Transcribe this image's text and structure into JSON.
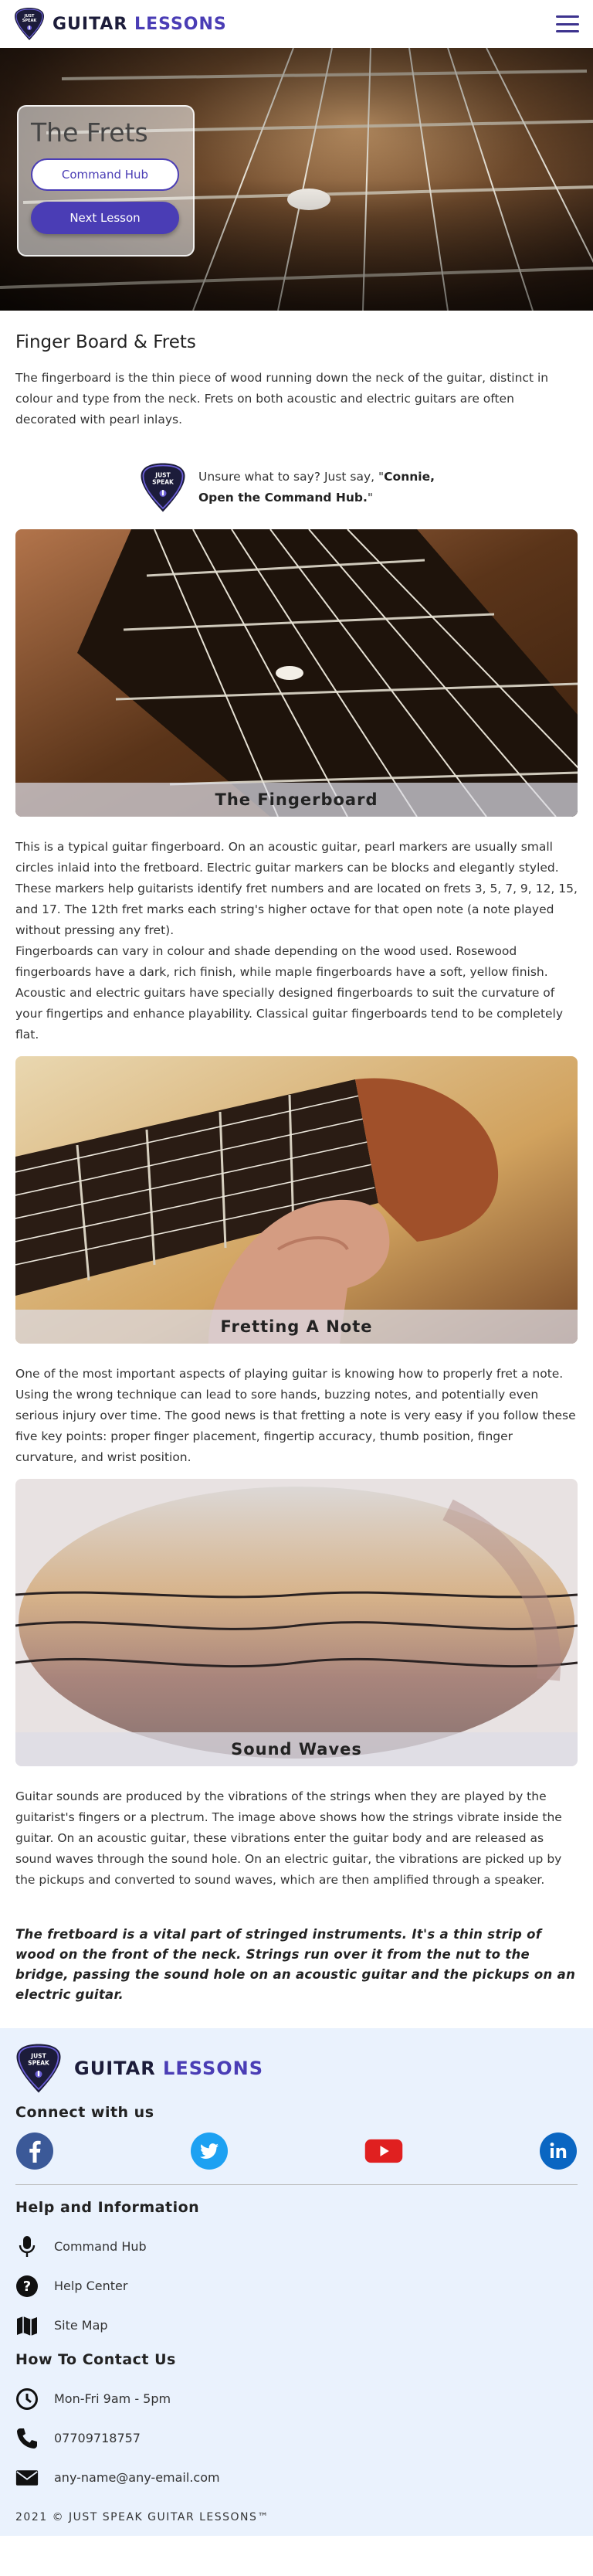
{
  "header": {
    "logo_text": "JUST SPEAK",
    "brand_word1": "GUITAR",
    "brand_word2": "LESSONS"
  },
  "hero": {
    "title": "The Frets",
    "command_hub_button": "Command Hub",
    "next_lesson_button": "Next Lesson"
  },
  "section": {
    "title": "Finger Board & Frets",
    "intro": "The fingerboard is the thin piece of wood running down the neck of the guitar, distinct in colour and type from the neck. Frets on both acoustic and electric guitars are often decorated with pearl inlays."
  },
  "hint": {
    "prefix": "Unsure what to say? Just say, \"",
    "command": "Connie, Open the Command Hub.",
    "suffix": "\""
  },
  "cards": [
    {
      "caption": "The Fingerboard",
      "paragraphs": [
        "This is a typical guitar fingerboard. On an acoustic guitar, pearl markers are usually small circles inlaid into the fretboard. Electric guitar markers can be blocks and elegantly styled.",
        "These markers help guitarists identify fret numbers and are located on frets 3, 5, 7, 9, 12, 15, and 17. The 12th fret marks each string's higher octave for that open note (a note played without pressing any fret).",
        "Fingerboards can vary in colour and shade depending on the wood used. Rosewood fingerboards have a dark, rich finish, while maple fingerboards have a soft, yellow finish. Acoustic and electric guitars have specially designed fingerboards to suit the curvature of your fingertips and enhance playability. Classical guitar fingerboards tend to be completely flat."
      ]
    },
    {
      "caption": "Fretting A Note",
      "paragraphs": [
        "One of the most important aspects of playing guitar is knowing how to properly fret a note. Using the wrong technique can lead to sore hands, buzzing notes, and potentially even serious injury over time. The good news is that fretting a note is very easy if you follow these five key points: proper finger placement, fingertip accuracy, thumb position, finger curvature, and wrist position."
      ]
    },
    {
      "caption": "Sound Waves",
      "paragraphs": [
        "Guitar sounds are produced by the vibrations of the strings when they are played by the guitarist's fingers or a plectrum. The image above shows how the strings vibrate inside the guitar. On an acoustic guitar, these vibrations enter the guitar body and are released as sound waves through the sound hole. On an electric guitar, the vibrations are picked up by the pickups and converted to sound waves, which are then amplified through a speaker."
      ]
    }
  ],
  "quote": "The fretboard is a vital part of stringed instruments. It's a thin strip of wood on the front of the neck. Strings run over it from the nut to the bridge, passing the sound hole on an acoustic guitar and the pickups on an electric guitar.",
  "footer": {
    "connect_heading": "Connect with us",
    "help_heading": "Help and Information",
    "help_links": [
      "Command Hub",
      "Help Center",
      "Site Map"
    ],
    "contact_heading": "How To Contact Us",
    "hours": "Mon-Fri 9am - 5pm",
    "phone": "07709718757",
    "email": "any-name@any-email.com",
    "copyright": "2021 © JUST SPEAK GUITAR LESSONS™"
  },
  "colors": {
    "brand_purple": "#4a3db5",
    "brand_dark": "#1c1c3a",
    "footer_bg": "#eaf2fd",
    "facebook": "#3b5998",
    "twitter": "#1da1f2",
    "youtube": "#e02020",
    "linkedin": "#0a66c2"
  },
  "icons": [
    "menu-icon",
    "facebook-icon",
    "twitter-icon",
    "youtube-icon",
    "linkedin-icon",
    "microphone-icon",
    "help-icon",
    "map-icon",
    "clock-icon",
    "phone-icon",
    "mail-icon"
  ]
}
